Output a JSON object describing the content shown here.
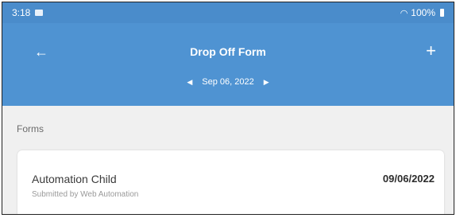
{
  "status": {
    "time": "3:18",
    "battery": "100%"
  },
  "header": {
    "title": "Drop Off Form",
    "back_icon": "←",
    "add_icon": "+",
    "date": "Sep 06, 2022",
    "prev_icon": "◀",
    "next_icon": "▶"
  },
  "section": {
    "label": "Forms"
  },
  "form_item": {
    "name": "Automation Child",
    "date": "09/06/2022",
    "submitted_by": "Submitted by Web Automation"
  },
  "colors": {
    "header_bg": "#4f93d2",
    "status_bg": "#4a8ccb",
    "page_bg": "#f0f0f0"
  }
}
